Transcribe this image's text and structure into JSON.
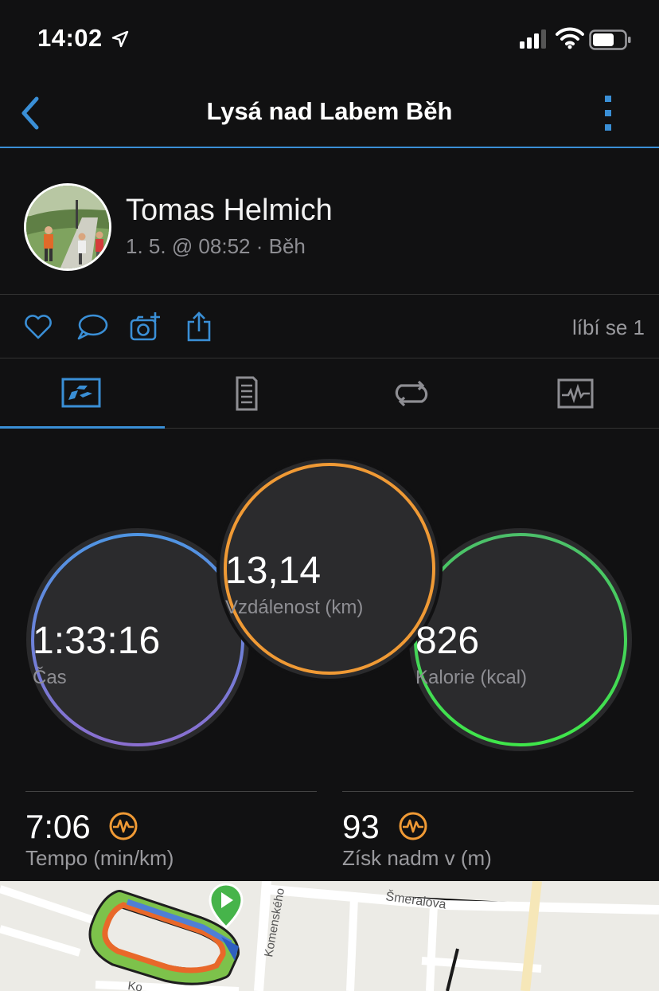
{
  "status": {
    "time": "14:02"
  },
  "nav": {
    "title": "Lysá nad Labem Běh",
    "accent": "#3a8fd6"
  },
  "profile": {
    "name": "Tomas Helmich",
    "meta": "1. 5. @ 08:52 · Běh"
  },
  "actions": {
    "likes_text": "líbí se 1",
    "icons": [
      "heart-icon",
      "comment-icon",
      "add-photo-icon",
      "share-icon"
    ]
  },
  "tabs": [
    {
      "icon": "stats-icon",
      "active": true
    },
    {
      "icon": "details-icon",
      "active": false
    },
    {
      "icon": "laps-icon",
      "active": false
    },
    {
      "icon": "chart-icon",
      "active": false
    }
  ],
  "stats": {
    "time": {
      "value": "1:33:16",
      "label": "Čas",
      "color": "#5b8fd8"
    },
    "distance": {
      "value": "13,14",
      "label": "Vzdálenost (km)",
      "color": "#f09a35"
    },
    "calories": {
      "value": "826",
      "label": "Kalorie (kcal)",
      "color": "#49c25a"
    }
  },
  "metrics": [
    {
      "value": "7:06",
      "label": "Tempo (min/km)",
      "icon": "activity-icon"
    },
    {
      "value": "93",
      "label": "Získ nadm v (m)",
      "icon": "activity-icon"
    }
  ],
  "map": {
    "streets": [
      "Šmeralova",
      "Komenského",
      "Ko"
    ]
  }
}
